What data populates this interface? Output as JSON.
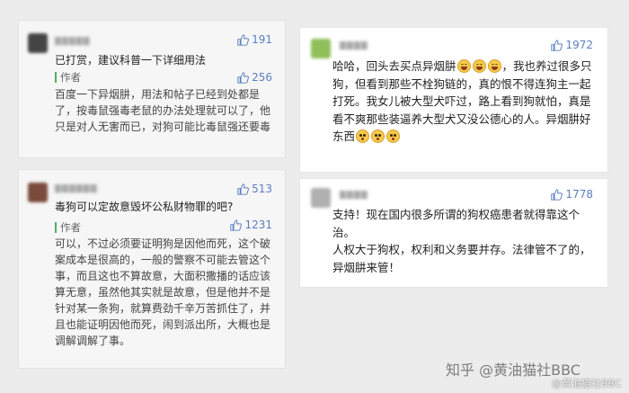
{
  "comments": [
    {
      "id": "c1",
      "likes": "191",
      "text": "已打赏，建议科普一下详细用法",
      "reply": {
        "tag": "作者",
        "likes": "256",
        "text": "百度一下异烟肼，用法和帖子已经到处都是了，按毒鼠强毒老鼠的办法处理就可以了，他只是对人无害而已，对狗可能比毒鼠强还要毒"
      }
    },
    {
      "id": "c2",
      "likes": "513",
      "text": "毒狗可以定故意毁坏公私财物罪的吧?",
      "reply": {
        "tag": "作者",
        "likes": "1231",
        "text": "可以，不过必须要证明狗是因他而死，这个破案成本是很高的，一般的警察不可能去管这个事，而且这也不算故意，大面积撒播的话应该算无意，虽然他其实就是故意，但是他并不是针对某一条狗，就算费劲千辛万苦抓住了，并且也能证明因他而死，闹到派出所，大概也是调解调解了事。"
      }
    },
    {
      "id": "c3",
      "likes": "1972",
      "text_parts": [
        "哈哈，回头去买点异烟肼",
        "，我也养过很多只狗，但看到那些不栓狗链的，真的恨不得连狗主一起打死。我女儿被大型犬吓过，路上看到狗就怕，真是看不爽那些装逼养大型犬又没公德心的人。异烟肼好东西"
      ]
    },
    {
      "id": "c4",
      "likes": "1778",
      "text": "支持！现在国内很多所谓的狗权癌患者就得靠这个治。\n人权大于狗权，权利和义务要并存。法律管不了的，异烟肼来管！"
    }
  ],
  "watermark": {
    "main": "知乎 @黄油猫社BBC",
    "sub": "@黄油猫社BBC"
  },
  "colors": {
    "like": "#5a7fbf",
    "reply_bar": "#59a869"
  },
  "icons": [
    "thumbs-up-icon",
    "laugh-emoji-icon",
    "flushed-emoji-icon"
  ]
}
